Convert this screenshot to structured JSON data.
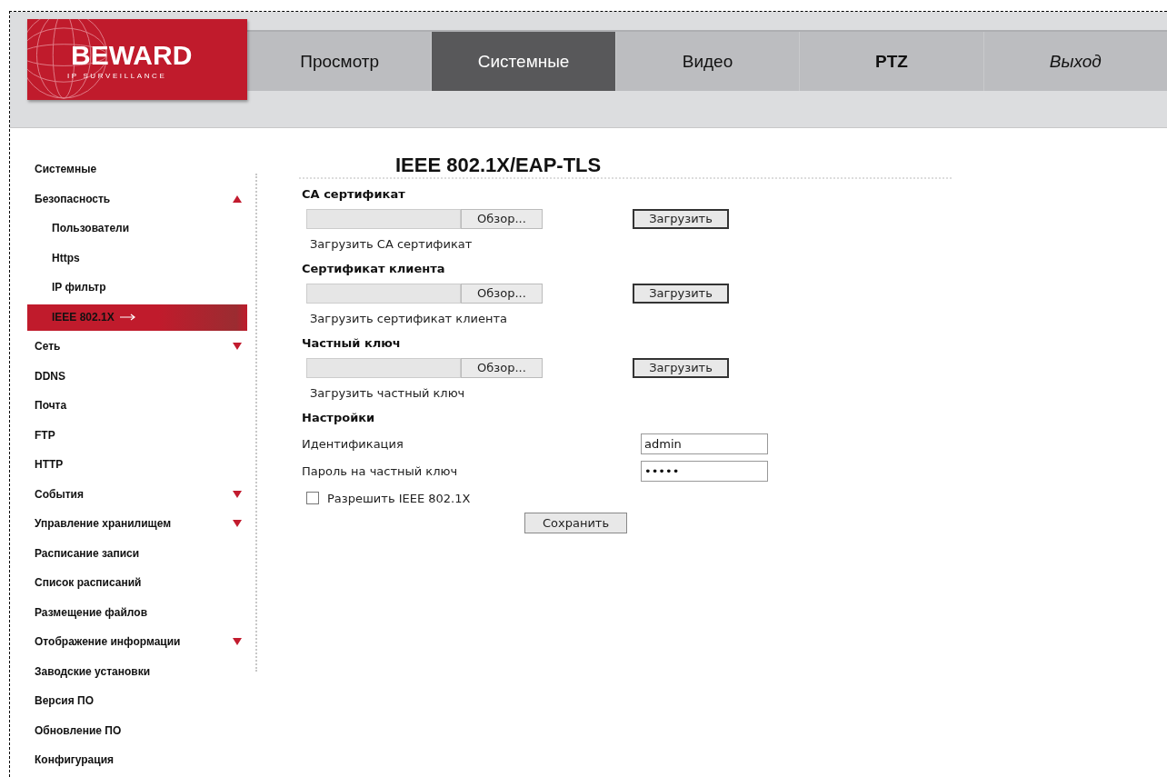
{
  "logo": {
    "brand": "BEWARD",
    "tagline": "IP SURVEILLANCE"
  },
  "tabs": [
    {
      "label": "Просмотр",
      "selected": false,
      "kind": "normal"
    },
    {
      "label": "Системные",
      "selected": true,
      "kind": "normal"
    },
    {
      "label": "Видео",
      "selected": false,
      "kind": "normal"
    },
    {
      "label": "PTZ",
      "selected": false,
      "kind": "bold"
    },
    {
      "label": "Выход",
      "selected": false,
      "kind": "italic"
    }
  ],
  "sidebar": {
    "items": [
      {
        "label": "Системные",
        "selected": false
      },
      {
        "label": "Безопасность",
        "selected": false,
        "expanded": true,
        "children": [
          {
            "label": "Пользователи",
            "selected": false
          },
          {
            "label": "Https",
            "selected": false
          },
          {
            "label": "IP фильтр",
            "selected": false
          },
          {
            "label": "IEEE 802.1X",
            "selected": true
          }
        ]
      },
      {
        "label": "Сеть",
        "selected": false,
        "expanded": false
      },
      {
        "label": "DDNS",
        "selected": false
      },
      {
        "label": "Почта",
        "selected": false
      },
      {
        "label": "FTP",
        "selected": false
      },
      {
        "label": "HTTP",
        "selected": false
      },
      {
        "label": "События",
        "selected": false,
        "expanded": false
      },
      {
        "label": "Управление хранилищем",
        "selected": false,
        "expanded": false
      },
      {
        "label": "Расписание записи",
        "selected": false
      },
      {
        "label": "Список расписаний",
        "selected": false
      },
      {
        "label": "Размещение файлов",
        "selected": false
      },
      {
        "label": "Отображение информации",
        "selected": false,
        "expanded": false
      },
      {
        "label": "Заводские установки",
        "selected": false
      },
      {
        "label": "Версия ПО",
        "selected": false
      },
      {
        "label": "Обновление ПО",
        "selected": false
      },
      {
        "label": "Конфигурация",
        "selected": false
      }
    ]
  },
  "page_title": "IEEE 802.1X/EAP-TLS",
  "certificates": [
    {
      "heading": "CA сертификат",
      "browse": "Обзор...",
      "upload": "Загрузить",
      "hint": "Загрузить CA сертификат"
    },
    {
      "heading": "Сертификат клиента",
      "browse": "Обзор...",
      "upload": "Загрузить",
      "hint": "Загрузить сертификат клиента"
    },
    {
      "heading": "Частный ключ",
      "browse": "Обзор...",
      "upload": "Загрузить",
      "hint": "Загрузить частный ключ"
    }
  ],
  "settings": {
    "heading": "Настройки",
    "fields": [
      {
        "label": "Идентификация",
        "value": "admin"
      },
      {
        "label": "Пароль на частный ключ",
        "value": "•••••"
      }
    ],
    "enable": {
      "label": "Разрешить IEEE 802.1X",
      "checked": false
    },
    "save": "Сохранить"
  }
}
